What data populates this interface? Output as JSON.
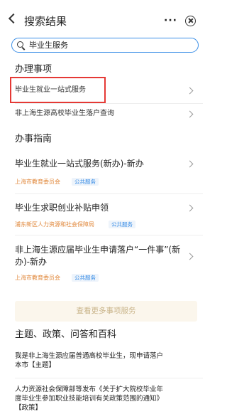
{
  "header": {
    "title": "搜索结果",
    "more_label": "···"
  },
  "search": {
    "value": "毕业生服务"
  },
  "section_handle": {
    "title": "办理事项",
    "items": [
      {
        "label": "毕业生就业一站式服务"
      },
      {
        "label": "非上海生源高校毕业生落户查询"
      }
    ]
  },
  "section_guide": {
    "title": "办事指南",
    "items": [
      {
        "label": "毕业生就业一站式服务(新办)-新办",
        "agency": "上海市教育委员会",
        "tag": "公共服务"
      },
      {
        "label": "毕业生求职创业补贴申领",
        "agency": "浦东新区人力资源和社会保障局",
        "tag": "公共服务"
      },
      {
        "label_line1": "非上海生源应届毕业生申请落户“一件事”(新",
        "label_line2": "办)-新办",
        "agency": "上海市教育委员会",
        "tag": "公共服务"
      }
    ],
    "more_button": "查看更多事项服务"
  },
  "section_topics": {
    "title": "主题、政策、问答和百科",
    "items": [
      {
        "line1": "我是非上海生源应届普通高校毕业生，现申请落户",
        "line2": "本市【主题】"
      },
      {
        "line1": "人力资源社会保障部等发布《关于扩大院校毕业年",
        "line2": "度毕业生参加职业技能培训有关政策范围的通知》",
        "line3": "【政策】"
      }
    ]
  },
  "colors": {
    "accent": "#3a8ee6",
    "highlight": "#e53935",
    "agency": "#e0873a"
  }
}
